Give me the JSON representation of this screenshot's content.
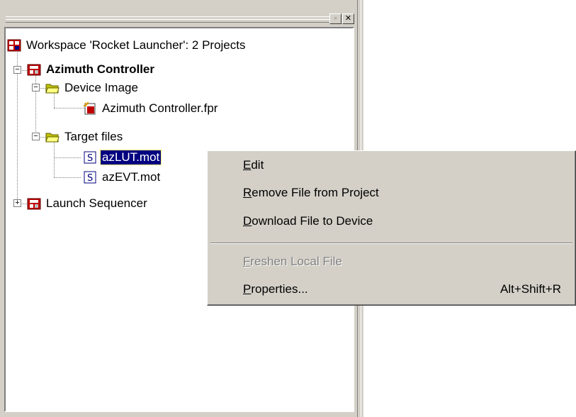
{
  "panel": {
    "window_buttons": {
      "maximize": "▫",
      "close": "✕"
    }
  },
  "tree": {
    "workspace": {
      "label": "Workspace 'Rocket Launcher': 2 Projects",
      "icon": "workspace-icon"
    },
    "project1": {
      "label": "Azimuth Controller",
      "expander": "−",
      "icon": "project-icon"
    },
    "device_image": {
      "label": "Device Image",
      "expander": "−",
      "icon": "folder-open-icon"
    },
    "fpr_file": {
      "label": "Azimuth Controller.fpr",
      "icon": "device-image-file-icon"
    },
    "target_files": {
      "label": "Target files",
      "expander": "−",
      "icon": "folder-open-icon"
    },
    "mot1": {
      "label": "azLUT.mot",
      "icon": "s-record-file-icon",
      "selected": true
    },
    "mot2": {
      "label": "azEVT.mot",
      "icon": "s-record-file-icon"
    },
    "project2": {
      "label": "Launch Sequencer",
      "expander": "+",
      "icon": "project-icon"
    }
  },
  "context_menu": {
    "items": [
      {
        "accel": "E",
        "rest": "dit",
        "shortcut": "",
        "enabled": true
      },
      {
        "accel": "R",
        "rest": "emove File from Project",
        "shortcut": "",
        "enabled": true
      },
      {
        "accel": "D",
        "rest": "ownload File to Device",
        "shortcut": "",
        "enabled": true
      },
      {
        "accel": "F",
        "rest": "reshen Local File",
        "shortcut": "",
        "enabled": false
      },
      {
        "accel": "P",
        "rest": "roperties...",
        "shortcut": "Alt+Shift+R",
        "enabled": true
      }
    ]
  },
  "colors": {
    "face": "#d4d0c8",
    "selection": "#000080",
    "disabled_text": "#808080"
  }
}
